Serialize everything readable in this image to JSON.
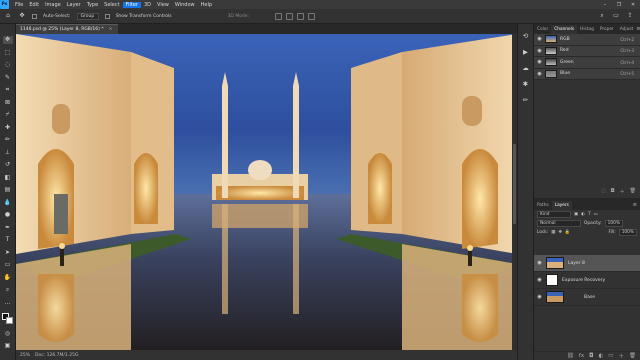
{
  "menu": {
    "logo": "Ps",
    "items": [
      "File",
      "Edit",
      "Image",
      "Layer",
      "Type",
      "Select",
      "Filter",
      "3D",
      "View",
      "Window",
      "Help"
    ],
    "active_item": "Filter",
    "window_controls": [
      "–",
      "❐",
      "✕"
    ]
  },
  "options": {
    "auto_select_label": "Auto-Select:",
    "auto_select_value": "Group",
    "show_transform_label": "Show Transform Controls",
    "mode_3d_label": "3D Mode:"
  },
  "document": {
    "tab_title": "1146.psd @ 25% (Layer 8, RGB/16) *",
    "tab_close": "×",
    "zoom": "25%",
    "doc_info": "Doc: 126.7M/1.25G"
  },
  "channels_panel": {
    "tabs": [
      "Color",
      "Channels",
      "Histog",
      "Proper",
      "Adjust"
    ],
    "active_tab": "Channels",
    "channels": [
      {
        "name": "RGB",
        "shortcut": "Ctrl+2"
      },
      {
        "name": "Red",
        "shortcut": "Ctrl+3"
      },
      {
        "name": "Green",
        "shortcut": "Ctrl+4"
      },
      {
        "name": "Blue",
        "shortcut": "Ctrl+5"
      }
    ]
  },
  "layers_panel": {
    "tabs": [
      "Paths",
      "Layers"
    ],
    "active_tab": "Layers",
    "filter_value": "Kind",
    "blend_mode": "Normal",
    "opacity_label": "Opacity:",
    "opacity_value": "100%",
    "lock_label": "Lock:",
    "fill_label": "Fill:",
    "fill_value": "100%",
    "layers": [
      {
        "name": "Layer 8",
        "selected": true
      },
      {
        "name": "Exposure Recovery",
        "selected": false
      },
      {
        "name": "Base",
        "selected": false
      }
    ]
  },
  "colors": {
    "accent": "#1473e6",
    "sky": "#2a4f9a",
    "sandstone": "#e8c9a0"
  }
}
